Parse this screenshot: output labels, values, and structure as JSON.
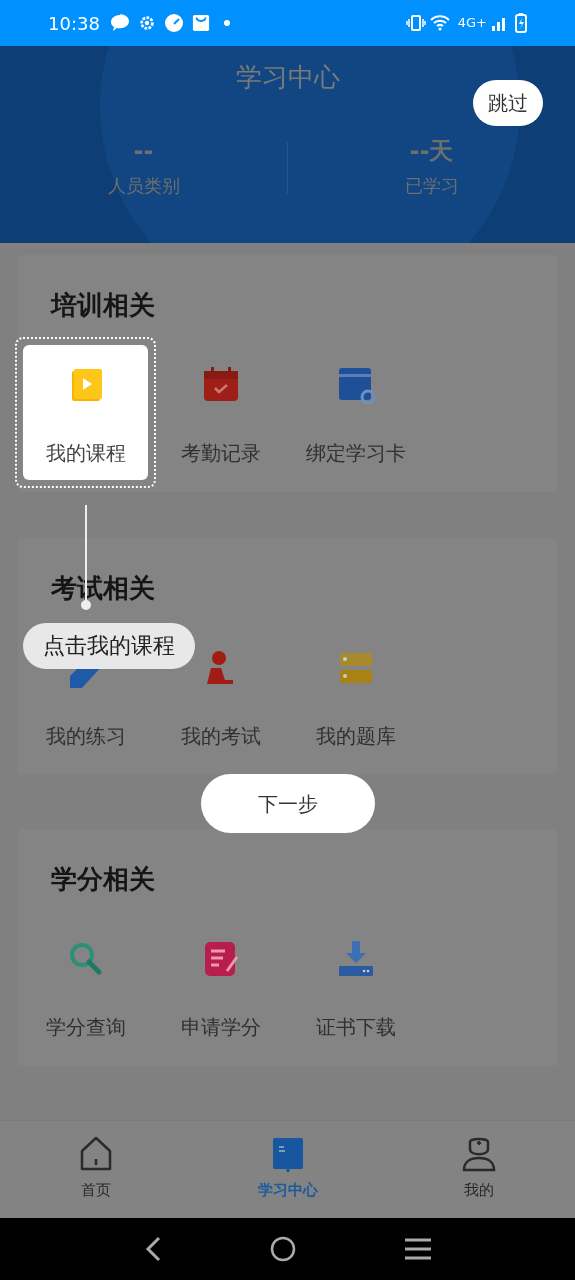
{
  "status_bar": {
    "time": "10:38",
    "network": "4G+"
  },
  "header": {
    "title": "学习中心",
    "stats": [
      {
        "value": "--",
        "label": "人员类别"
      },
      {
        "value": "--天",
        "label": "已学习"
      }
    ]
  },
  "sections": [
    {
      "title": "培训相关",
      "items": [
        {
          "label": "我的课程",
          "highlighted": true
        },
        {
          "label": "考勤记录",
          "highlighted": false
        },
        {
          "label": "绑定学习卡",
          "highlighted": false
        }
      ]
    },
    {
      "title": "考试相关",
      "items": [
        {
          "label": "我的练习",
          "highlighted": false
        },
        {
          "label": "我的考试",
          "highlighted": false
        },
        {
          "label": "我的题库",
          "highlighted": false
        }
      ]
    },
    {
      "title": "学分相关",
      "items": [
        {
          "label": "学分查询",
          "highlighted": false
        },
        {
          "label": "申请学分",
          "highlighted": false
        },
        {
          "label": "证书下载",
          "highlighted": false
        }
      ]
    }
  ],
  "tab_bar": [
    {
      "label": "首页",
      "selected": false
    },
    {
      "label": "学习中心",
      "selected": true
    },
    {
      "label": "我的",
      "selected": false
    }
  ],
  "guide": {
    "skip": "跳过",
    "tip": "点击我的课程",
    "next": "下一步"
  }
}
